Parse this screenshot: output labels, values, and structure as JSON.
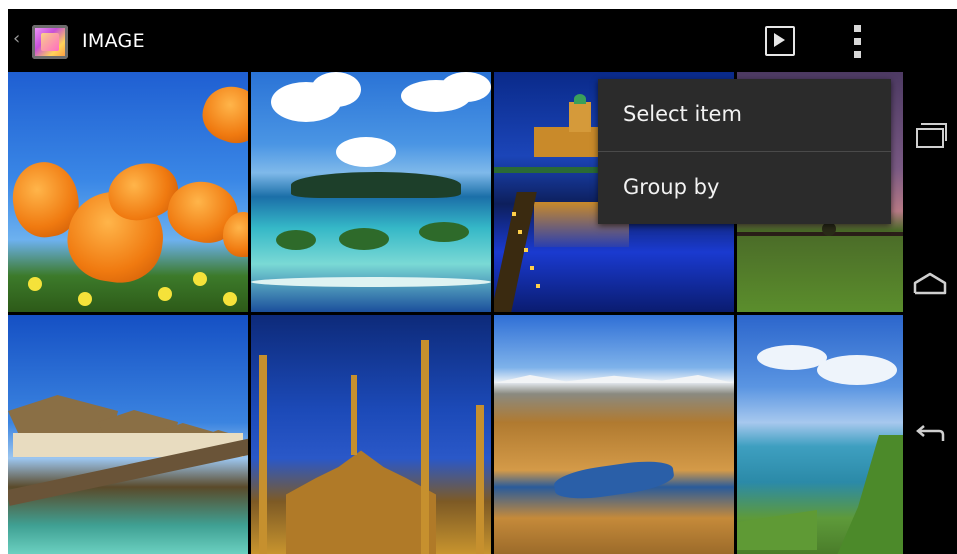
{
  "action_bar": {
    "title": "IMAGE",
    "icons": [
      "up-caret-icon",
      "gallery-app-icon",
      "slideshow-icon",
      "overflow-menu-icon"
    ]
  },
  "grid": {
    "tiles": [
      {
        "name": "orange-poppies-photo"
      },
      {
        "name": "tropical-islands-photo"
      },
      {
        "name": "lit-palace-reflection-photo"
      },
      {
        "name": "sunset-field-photo"
      },
      {
        "name": "overwater-huts-photo"
      },
      {
        "name": "mosque-photo"
      },
      {
        "name": "tundra-lake-photo"
      },
      {
        "name": "coastline-photo"
      }
    ]
  },
  "menu": {
    "items": [
      {
        "label": "Select item"
      },
      {
        "label": "Group by"
      }
    ]
  },
  "nav_bar": {
    "icons": [
      "recent-apps-icon",
      "home-icon",
      "back-icon"
    ]
  },
  "colors": {
    "background": "#000000",
    "menu_background": "#2b2b2b",
    "menu_text": "#f2f2f2",
    "nav_icon": "#cfcfcf"
  }
}
